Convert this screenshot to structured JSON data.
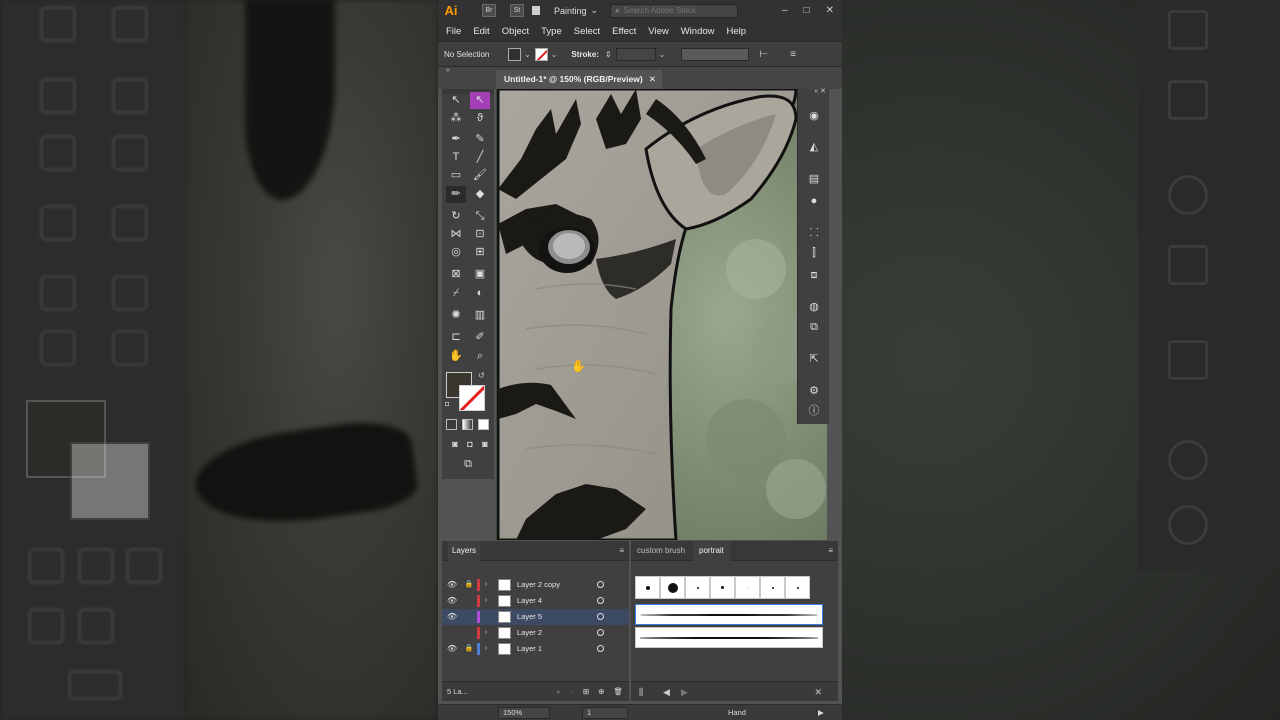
{
  "app": {
    "logo": "Ai",
    "bridge_label": "Br",
    "stock_label": "St",
    "workspace": "Painting",
    "search_placeholder": "Search Adobe Stock",
    "window_controls": [
      "–",
      "□",
      "✕"
    ]
  },
  "menu": [
    "File",
    "Edit",
    "Object",
    "Type",
    "Select",
    "Effect",
    "View",
    "Window",
    "Help"
  ],
  "control_bar": {
    "selection": "No Selection",
    "stroke_label": "Stroke:"
  },
  "document_tab": {
    "title": "Untitled-1* @ 150% (RGB/Preview)",
    "close": "✕"
  },
  "colors": {
    "fill": "#3a352f",
    "accent_selected": "#3c4b63",
    "brand": "#ff9a00"
  },
  "layers_panel": {
    "title": "Layers",
    "footer_count": "5 La...",
    "layers": [
      {
        "name": "Layer 2 copy",
        "visible": true,
        "locked": true,
        "color": "#d23b3b"
      },
      {
        "name": "Layer 4",
        "visible": true,
        "locked": false,
        "color": "#d23b3b"
      },
      {
        "name": "Layer 5",
        "visible": true,
        "locked": false,
        "color": "#b04fd6",
        "selected": true
      },
      {
        "name": "Layer 2",
        "visible": false,
        "locked": false,
        "color": "#d23b3b"
      },
      {
        "name": "Layer 1",
        "visible": true,
        "locked": true,
        "color": "#4f7fd6"
      }
    ]
  },
  "brushes_panel": {
    "tabs": [
      "custom brush",
      "portrait"
    ],
    "active_tab": "portrait"
  },
  "status_bar": {
    "zoom": "150%",
    "page": "1",
    "tool": "Hand"
  }
}
